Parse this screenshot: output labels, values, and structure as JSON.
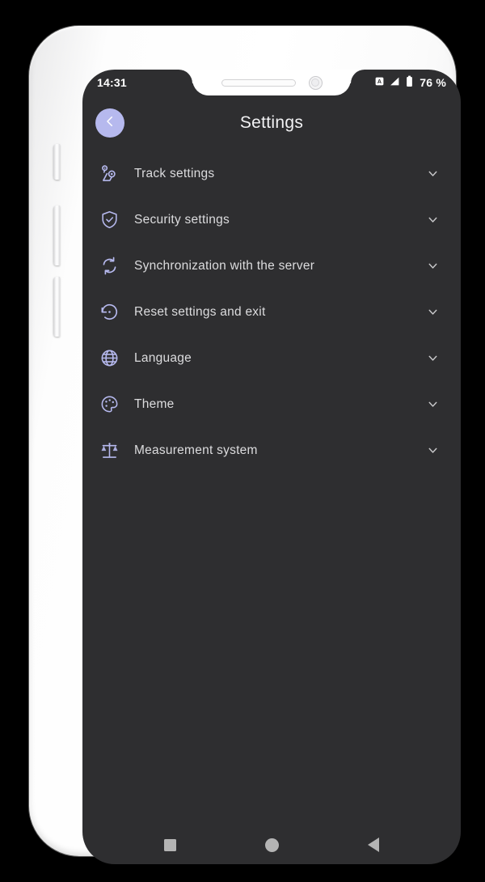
{
  "status_bar": {
    "time": "14:31",
    "battery_percent": "76 %",
    "icons": [
      "alarm-icon",
      "signal-icon",
      "battery-icon"
    ]
  },
  "app_bar": {
    "title": "Settings",
    "back_icon": "chevron-left-icon",
    "back_button_color": "#b6b9ee"
  },
  "settings": {
    "items": [
      {
        "label": "Track settings",
        "icon": "route-pins-icon"
      },
      {
        "label": "Security settings",
        "icon": "shield-check-icon"
      },
      {
        "label": "Synchronization with the server",
        "icon": "sync-icon"
      },
      {
        "label": "Reset settings and exit",
        "icon": "restore-icon"
      },
      {
        "label": "Language",
        "icon": "globe-icon"
      },
      {
        "label": "Theme",
        "icon": "palette-icon"
      },
      {
        "label": "Measurement system",
        "icon": "scales-icon"
      }
    ],
    "expand_icon": "chevron-down-icon"
  },
  "nav_bar": {
    "recents_icon": "square-icon",
    "home_icon": "circle-icon",
    "back_icon": "triangle-left-icon"
  },
  "theme": {
    "screen_background": "#2e2e30",
    "accent": "#b6b9ee",
    "label_color": "#dcdcde",
    "frame_color": "#ffffff"
  }
}
